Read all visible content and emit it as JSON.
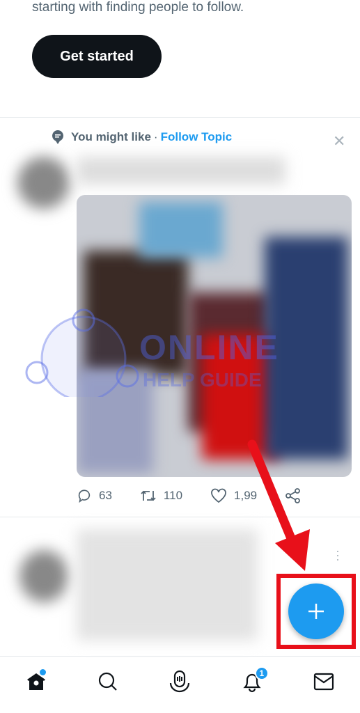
{
  "intro": {
    "text": "starting with finding people to follow.",
    "button": "Get started"
  },
  "context": {
    "label": "You might like",
    "separator": "·",
    "link": "Follow Topic"
  },
  "actions": {
    "replies": "63",
    "retweets": "110",
    "likes": "1,99"
  },
  "watermark": {
    "line1": "ONLINE",
    "line2": "HELP GUIDE"
  },
  "nav": {
    "items": [
      "home",
      "search",
      "spaces",
      "notifications",
      "messages"
    ],
    "notification_count": "1"
  },
  "colors": {
    "accent": "#1d9bf0",
    "annotation": "#e8101a"
  }
}
